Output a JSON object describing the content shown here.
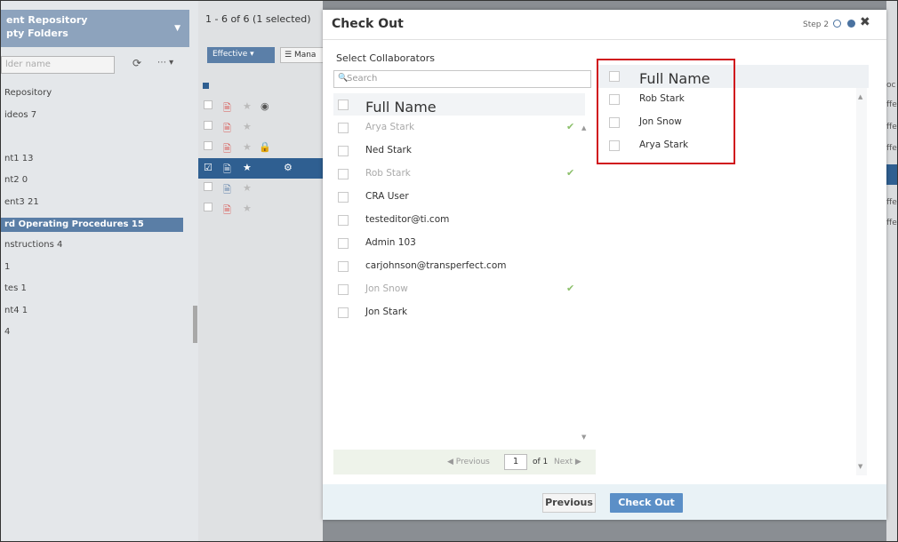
{
  "left_panel": {
    "header_line1": "ent Repository",
    "header_line2": "pty Folders",
    "filter_placeholder": "lder name",
    "tree": [
      "Repository",
      "ideos  7",
      "",
      "nt1  13",
      "nt2  0",
      "ent3  21",
      "rd Operating Procedures  15",
      "nstructions  4",
      "  1",
      "tes  1",
      "nt4  1",
      "  4"
    ]
  },
  "doc_list": {
    "count_text": "1 - 6 of 6 (1 selected)",
    "effective_label": "Effective",
    "manage_label": "Mana"
  },
  "right_strip": {
    "labels": [
      "oc",
      "ffe",
      "ffe",
      "ffe",
      "ffe",
      "ffe",
      "ffe"
    ]
  },
  "modal": {
    "title": "Check Out",
    "step_label": "Step 2",
    "select_label": "Select Collaborators",
    "search_placeholder": "Search",
    "left_column_header": "Full Name",
    "collaborators": [
      {
        "name": "Arya Stark",
        "disabled": true,
        "added": true
      },
      {
        "name": "Ned Stark",
        "disabled": false,
        "added": false
      },
      {
        "name": "Rob Stark",
        "disabled": true,
        "added": true
      },
      {
        "name": "CRA User",
        "disabled": false,
        "added": false
      },
      {
        "name": "testeditor@ti.com",
        "disabled": false,
        "added": false
      },
      {
        "name": "Admin 103",
        "disabled": false,
        "added": false
      },
      {
        "name": "carjohnson@transperfect.com",
        "disabled": false,
        "added": false
      },
      {
        "name": "Jon Snow",
        "disabled": true,
        "added": true
      },
      {
        "name": "Jon Stark",
        "disabled": false,
        "added": false
      }
    ],
    "pager": {
      "previous": "Previous",
      "page": "1",
      "of": "of 1",
      "next": "Next"
    },
    "right_column_header": "Full Name",
    "selected": [
      "Rob Stark",
      "Jon Snow",
      "Arya Stark"
    ],
    "footer": {
      "previous_label": "Previous",
      "checkout_label": "Check Out"
    }
  },
  "colors": {
    "accent": "#5b8fc7",
    "highlight_row": "#2f5f91",
    "annotation_red": "#d0141d",
    "check_green": "#8cc06b"
  }
}
